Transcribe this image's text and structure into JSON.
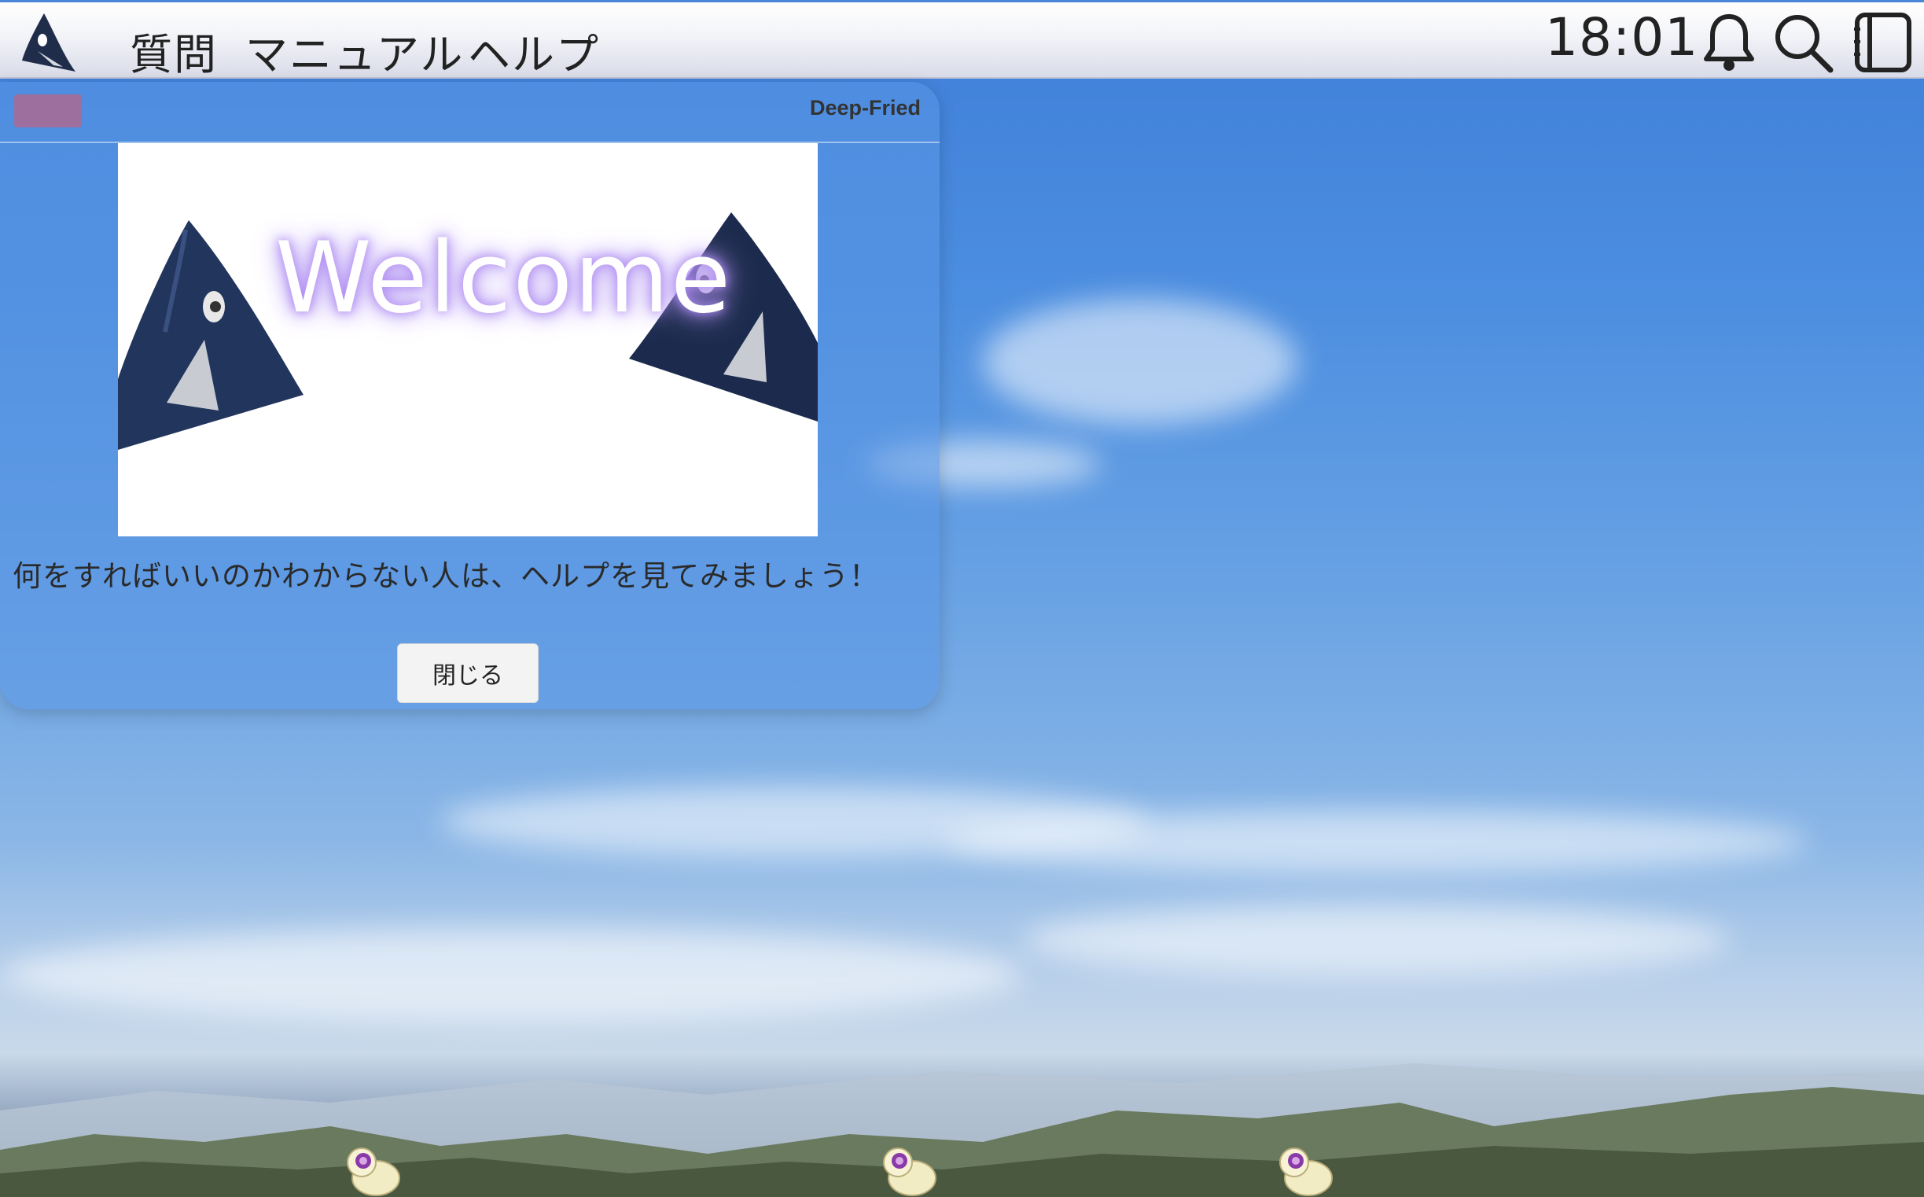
{
  "menubar": {
    "logo_icon": "fish-logo-icon",
    "items": [
      {
        "label": "質問"
      },
      {
        "label": "マニュアル"
      },
      {
        "label": "ヘルプ"
      }
    ],
    "clock": "18:01",
    "tray_icons": [
      "bell-icon",
      "search-icon",
      "sidebar-panel-icon"
    ]
  },
  "window": {
    "title": "Deep-Fried",
    "image_text": "Welcome",
    "message": "何をすればいいのかわからない人は、ヘルプを見てみましょう！",
    "close_button": "閉じる"
  },
  "colors": {
    "accent": "#4a86d8",
    "window_control": "#9c6f9f",
    "welcome_glow": "#b18cf2"
  }
}
